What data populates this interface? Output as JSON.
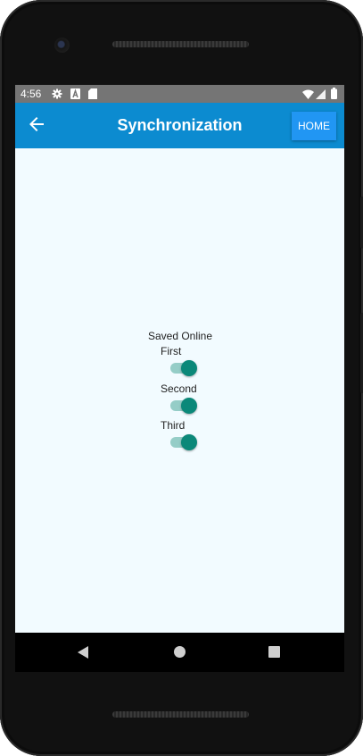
{
  "status_bar": {
    "time": "4:56",
    "icons": [
      "settings-icon",
      "a-icon",
      "sd-card-icon",
      "wifi-icon",
      "signal-icon",
      "battery-icon"
    ]
  },
  "app_bar": {
    "title": "Synchronization",
    "home_label": "HOME",
    "color": "#0c8bd0",
    "home_color": "#2196f3"
  },
  "sync": {
    "section_title": "Saved Online",
    "toggles": [
      {
        "label": "First",
        "on": true
      },
      {
        "label": "Second",
        "on": true
      },
      {
        "label": "Third",
        "on": true
      }
    ],
    "toggle_color": "#0b8879"
  },
  "nav_bar": {
    "buttons": [
      "back-icon",
      "home-icon",
      "recents-icon"
    ]
  }
}
